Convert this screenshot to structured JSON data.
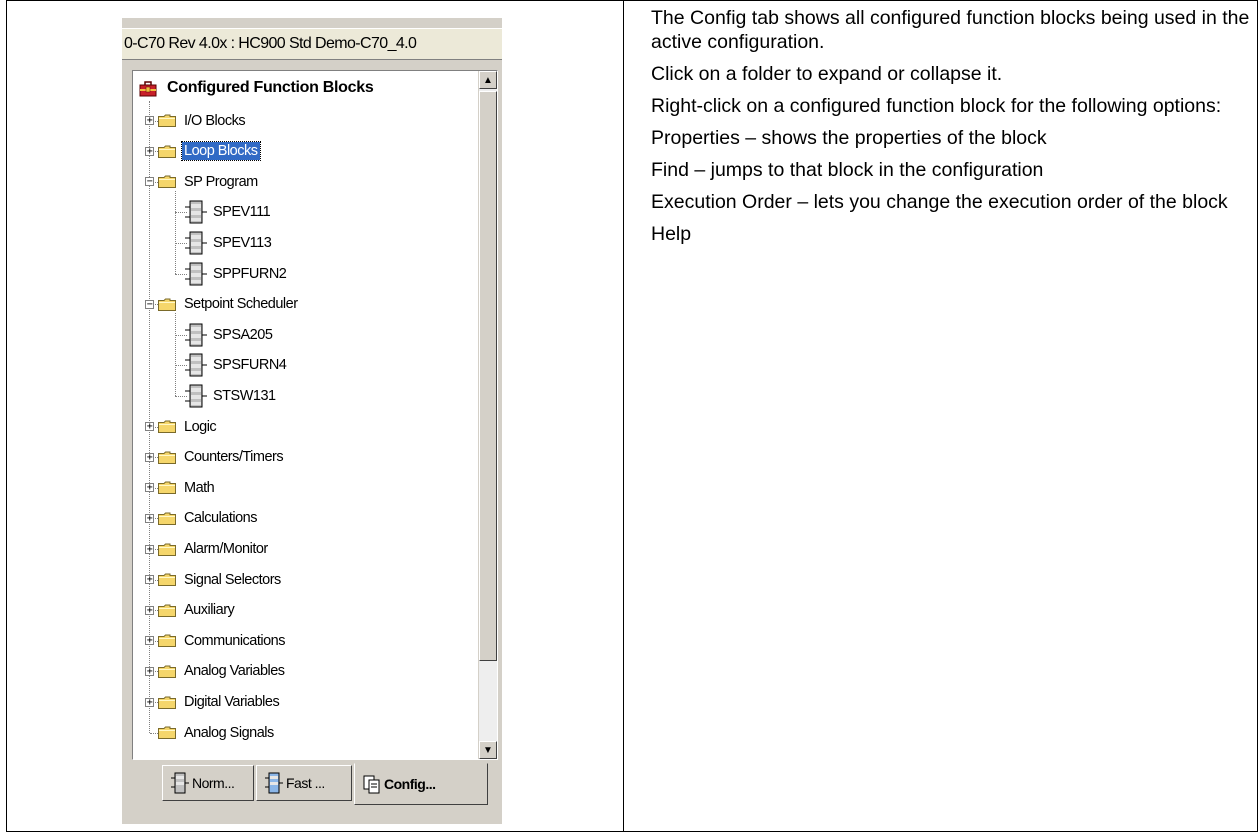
{
  "panel": {
    "title": "0-C70 Rev 4.0x : HC900 Std Demo-C70_4.0",
    "tree": {
      "root_label": "Configured Function Blocks",
      "items": [
        {
          "label": "I/O Blocks",
          "type": "folder",
          "state": "collapsed",
          "level": 1
        },
        {
          "label": "Loop Blocks",
          "type": "folder",
          "state": "collapsed",
          "level": 1,
          "selected": true
        },
        {
          "label": "SP Program",
          "type": "folder",
          "state": "expanded",
          "level": 1
        },
        {
          "label": "SPEV111",
          "type": "block",
          "level": 2
        },
        {
          "label": "SPEV113",
          "type": "block",
          "level": 2
        },
        {
          "label": "SPPFURN2",
          "type": "block",
          "level": 2
        },
        {
          "label": "Setpoint Scheduler",
          "type": "folder",
          "state": "expanded",
          "level": 1
        },
        {
          "label": "SPSA205",
          "type": "block",
          "level": 2
        },
        {
          "label": "SPSFURN4",
          "type": "block",
          "level": 2
        },
        {
          "label": "STSW131",
          "type": "block",
          "level": 2
        },
        {
          "label": "Logic",
          "type": "folder",
          "state": "collapsed",
          "level": 1
        },
        {
          "label": "Counters/Timers",
          "type": "folder",
          "state": "collapsed",
          "level": 1
        },
        {
          "label": "Math",
          "type": "folder",
          "state": "collapsed",
          "level": 1
        },
        {
          "label": "Calculations",
          "type": "folder",
          "state": "collapsed",
          "level": 1
        },
        {
          "label": "Alarm/Monitor",
          "type": "folder",
          "state": "collapsed",
          "level": 1
        },
        {
          "label": "Signal Selectors",
          "type": "folder",
          "state": "collapsed",
          "level": 1
        },
        {
          "label": "Auxiliary",
          "type": "folder",
          "state": "collapsed",
          "level": 1
        },
        {
          "label": "Communications",
          "type": "folder",
          "state": "collapsed",
          "level": 1
        },
        {
          "label": "Analog Variables",
          "type": "folder",
          "state": "collapsed",
          "level": 1
        },
        {
          "label": "Digital Variables",
          "type": "folder",
          "state": "collapsed",
          "level": 1
        },
        {
          "label": "Analog Signals",
          "type": "folder",
          "state": "none",
          "level": 1
        }
      ]
    },
    "tabs": [
      {
        "label": "Norm...",
        "icon": "block-icon"
      },
      {
        "label": "Fast ...",
        "icon": "fast-block-icon"
      },
      {
        "label": "Config...",
        "icon": "config-icon",
        "active": true
      }
    ]
  },
  "description": {
    "paragraphs": [
      "The Config tab shows all configured function blocks being used in the active configuration.",
      "Click on a folder to expand or collapse it.",
      "Right-click on a configured function block for the following options:",
      "Properties – shows the properties of the block",
      "Find – jumps to that block in the configuration",
      "Execution Order – lets you change the execution order of the block",
      "Help"
    ]
  },
  "colors": {
    "panel_bg": "#d4d0c8",
    "selection": "#316ac5",
    "folder": "#f5d66b"
  }
}
